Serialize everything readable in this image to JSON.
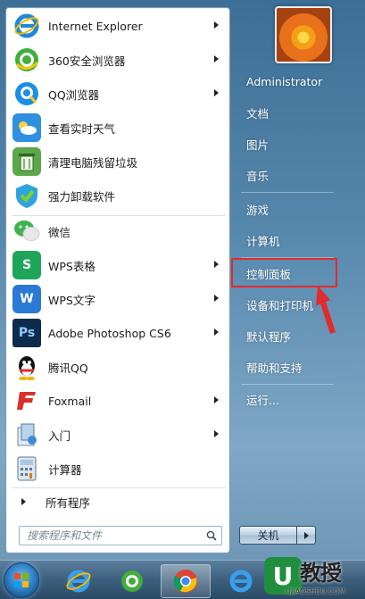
{
  "programs": [
    {
      "label": "Internet Explorer",
      "icon": "internet-explorer-icon",
      "submenu": true
    },
    {
      "label": "360安全浏览器",
      "icon": "360-browser-icon",
      "submenu": true
    },
    {
      "label": "QQ浏览器",
      "icon": "qq-browser-icon",
      "submenu": true
    },
    {
      "label": "查看实时天气",
      "icon": "weather-icon",
      "submenu": false
    },
    {
      "label": "清理电脑残留垃圾",
      "icon": "cleanup-icon",
      "submenu": false
    },
    {
      "label": "强力卸载软件",
      "icon": "uninstall-icon",
      "submenu": false
    },
    {
      "label": "微信",
      "icon": "wechat-icon",
      "submenu": false
    },
    {
      "label": "WPS表格",
      "icon": "wps-spreadsheet-icon",
      "submenu": true
    },
    {
      "label": "WPS文字",
      "icon": "wps-writer-icon",
      "submenu": true
    },
    {
      "label": "Adobe Photoshop CS6",
      "icon": "photoshop-icon",
      "submenu": true
    },
    {
      "label": "腾讯QQ",
      "icon": "qq-icon",
      "submenu": false
    },
    {
      "label": "Foxmail",
      "icon": "foxmail-icon",
      "submenu": true
    },
    {
      "label": "入门",
      "icon": "getting-started-icon",
      "submenu": true
    },
    {
      "label": "计算器",
      "icon": "calculator-icon",
      "submenu": false
    }
  ],
  "all_programs_label": "所有程序",
  "search": {
    "placeholder": "搜索程序和文件"
  },
  "user": {
    "name": "Administrator"
  },
  "right_items": [
    {
      "label": "文档"
    },
    {
      "label": "图片"
    },
    {
      "label": "音乐"
    },
    {
      "label": "游戏"
    },
    {
      "label": "计算机"
    },
    {
      "label": "控制面板"
    },
    {
      "label": "设备和打印机"
    },
    {
      "label": "默认程序"
    },
    {
      "label": "帮助和支持"
    },
    {
      "label": "运行..."
    }
  ],
  "shutdown": {
    "label": "关机"
  },
  "watermark": {
    "letter": "U",
    "title": "教授",
    "url": "UJIAOSHOU.COM"
  },
  "colors": {
    "highlight": "#e32a2a",
    "accent": "#2d7dc6"
  }
}
